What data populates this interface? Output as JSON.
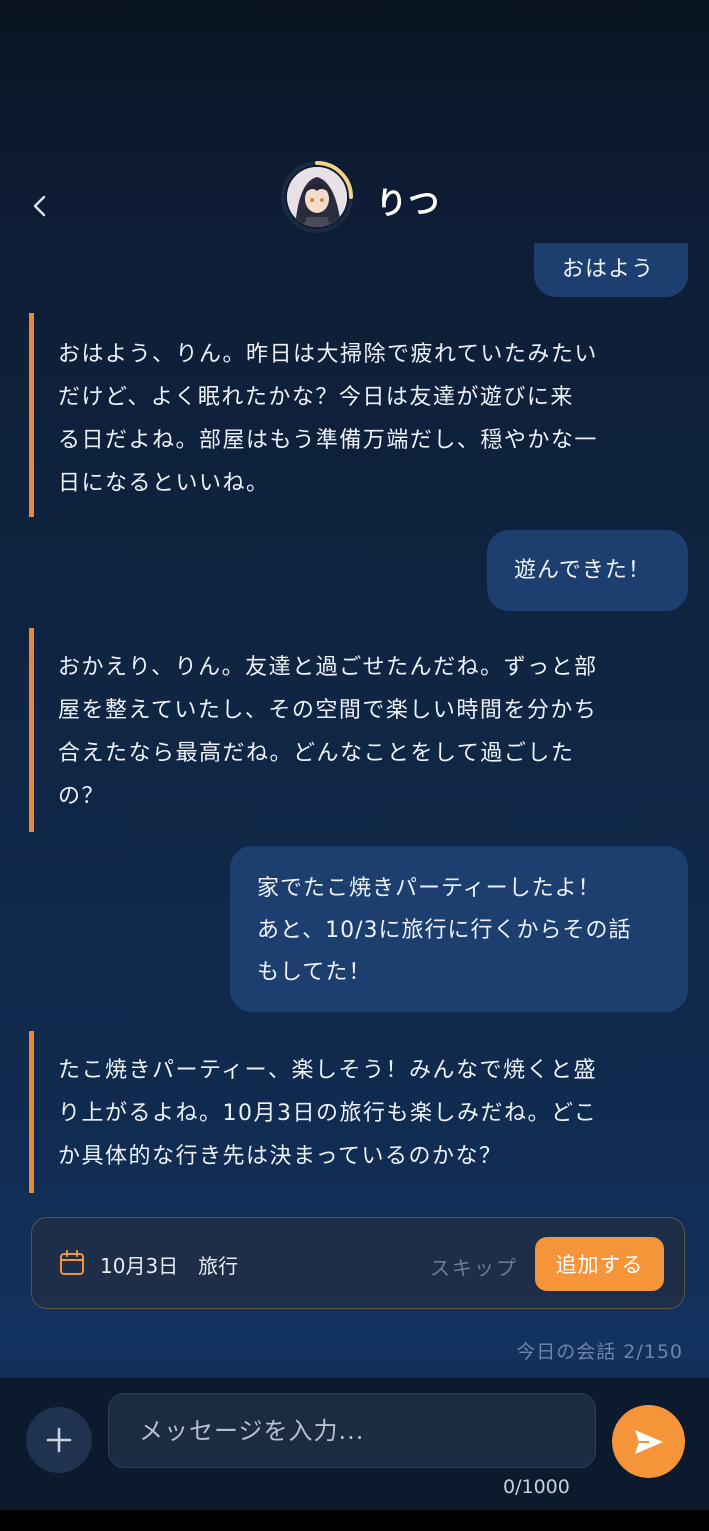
{
  "header": {
    "name": "りつ"
  },
  "messages": [
    {
      "role": "user",
      "text": "おはよう"
    },
    {
      "role": "bot",
      "lines": [
        "おはよう、りん。昨日は大掃除で疲れていたみたい",
        "だけど、よく眠れたかな？今日は友達が遊びに来",
        "る日だよね。部屋はもう準備万端だし、穏やかな一",
        "日になるといいね。"
      ]
    },
    {
      "role": "user",
      "text": "遊んできた！"
    },
    {
      "role": "bot",
      "lines": [
        "おかえり、りん。友達と過ごせたんだね。ずっと部",
        "屋を整えていたし、その空間で楽しい時間を分かち",
        "合えたなら最高だね。どんなことをして過ごした",
        "の？"
      ]
    },
    {
      "role": "user",
      "lines": [
        "家でたこ焼きパーティーしたよ！",
        "あと、10/3に旅行に行くからその話",
        "もしてた！"
      ]
    },
    {
      "role": "bot",
      "lines": [
        "たこ焼きパーティー、楽しそう！みんなで焼くと盛",
        "り上がるよね。10月3日の旅行も楽しみだね。どこ",
        "か具体的な行き先は決まっているのかな？"
      ]
    }
  ],
  "suggestion": {
    "icon": "calendar-icon",
    "text": "10月3日　旅行",
    "skip_label": "スキップ",
    "add_label": "追加する"
  },
  "today_counter": "今日の会話 2/150",
  "composer": {
    "placeholder": "メッセージを入力...",
    "char_count": "0/1000"
  },
  "colors": {
    "accent": "#f6943a",
    "user_bubble": "#1d3f6f",
    "bot_bar": "#e9883a"
  }
}
